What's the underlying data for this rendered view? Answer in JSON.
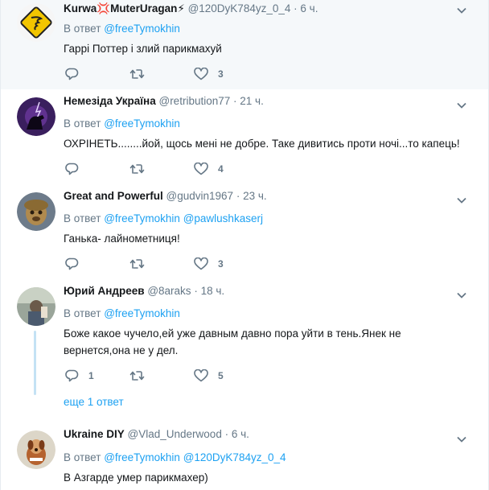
{
  "tweets": [
    {
      "name": "Kurwa💢MuterUragan⚡",
      "handle": "@120DyK784yz_0_4",
      "time": "6 ч.",
      "reply_prefix": "В ответ",
      "reply_to": [
        "@freeTymokhin"
      ],
      "text": [
        "Гаррі Поттер і злий парикмахуй"
      ],
      "replies": "",
      "retweets": "",
      "likes": "3"
    },
    {
      "name": "Немезіда Україна",
      "handle": "@retribution77",
      "time": "21 ч.",
      "reply_prefix": "В ответ",
      "reply_to": [
        "@freeTymokhin"
      ],
      "text": [
        "ОХРІНЕТЬ........йой, щось мені не добре. Таке дивитись проти ночі...то капець!"
      ],
      "replies": "",
      "retweets": "",
      "likes": "4"
    },
    {
      "name": "Great and Powerful",
      "handle": "@gudvin1967",
      "time": "23 ч.",
      "reply_prefix": "В ответ",
      "reply_to": [
        "@freeTymokhin",
        "@pawlushkaserj"
      ],
      "text": [
        "Ганька- лайнометниця!"
      ],
      "replies": "",
      "retweets": "",
      "likes": "3"
    },
    {
      "name": "Юрий Андреев",
      "handle": "@8araks",
      "time": "18 ч.",
      "reply_prefix": "В ответ",
      "reply_to": [
        "@freeTymokhin"
      ],
      "text": [
        "Боже какое чучело,ей уже давным давно пора уйти в тень.Янек не",
        "вернется,она не у дел."
      ],
      "replies": "1",
      "retweets": "",
      "likes": "5",
      "more_replies": "еще 1 ответ"
    },
    {
      "name": "Ukraine DIY",
      "handle": "@Vlad_Underwood",
      "time": "6 ч.",
      "reply_prefix": "В ответ",
      "reply_to": [
        "@freeTymokhin",
        "@120DyK784yz_0_4"
      ],
      "text": [
        "В Азгарде умер парикмахер)"
      ],
      "replies": "",
      "retweets": "",
      "likes": ""
    }
  ],
  "icons": {
    "reply": "reply-icon",
    "retweet": "retweet-icon",
    "like": "heart-icon",
    "menu": "chevron-down-icon"
  },
  "colors": {
    "link": "#1da1f2",
    "muted": "#657786",
    "thread_line": "#c4e2f4"
  }
}
